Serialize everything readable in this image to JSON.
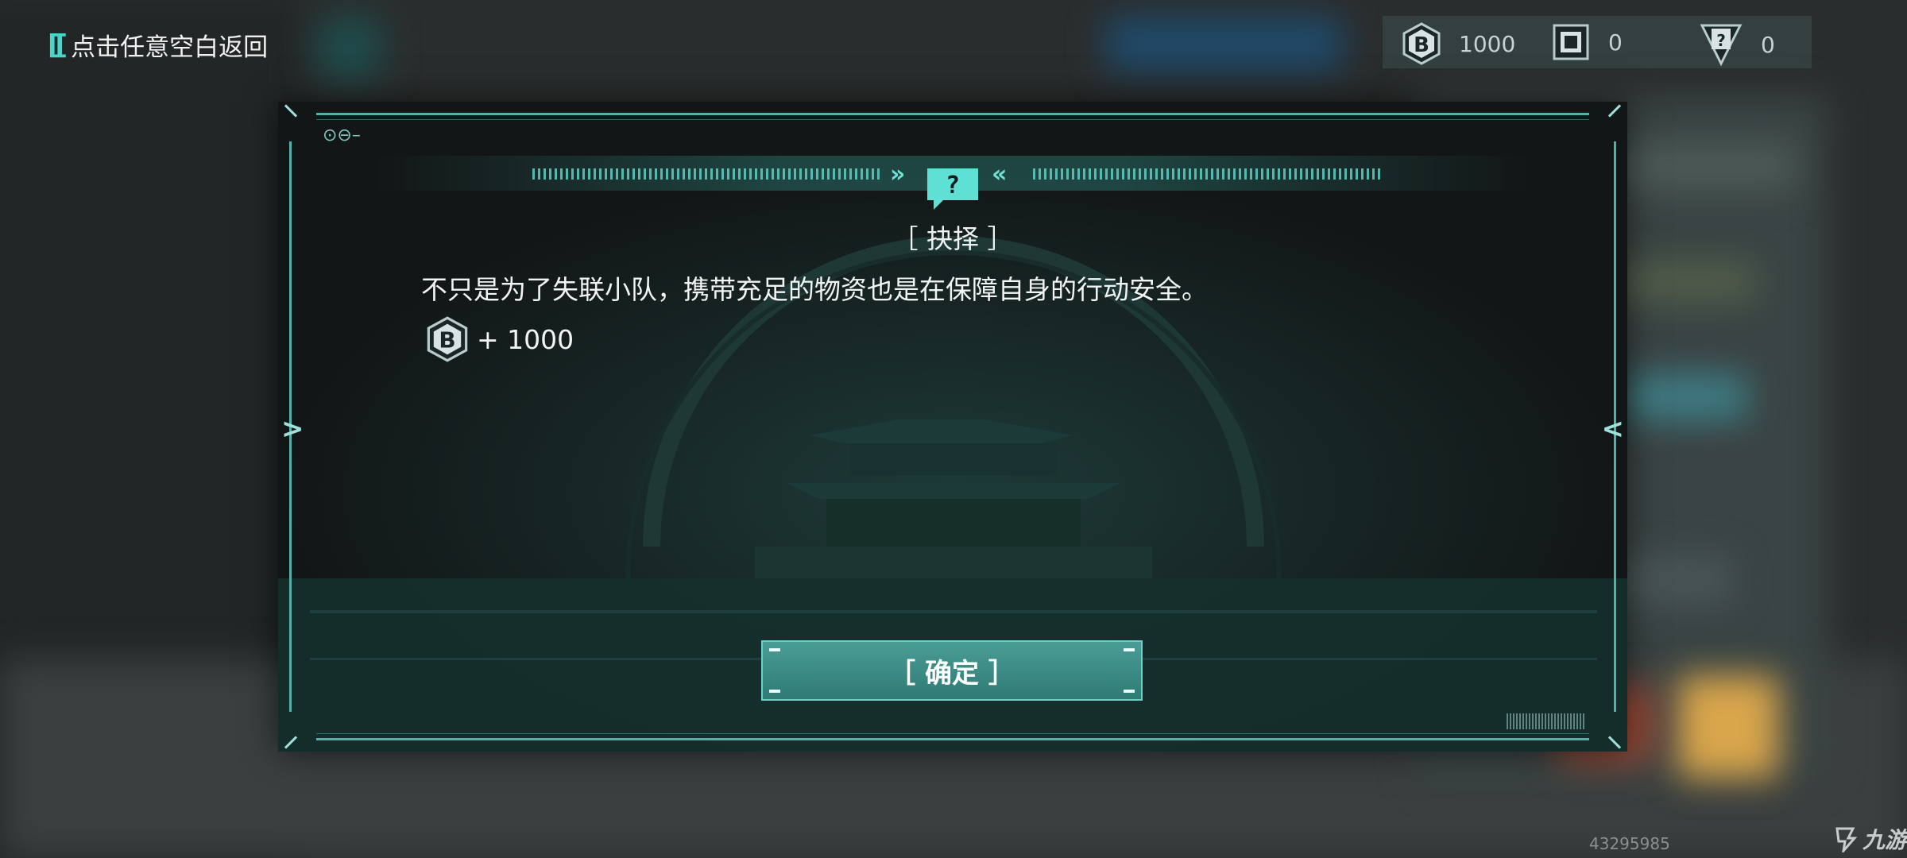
{
  "back_hint": {
    "icon": "double-bracket-icon",
    "text": "点击任意空白返回"
  },
  "currencies": [
    {
      "icon": "bit-coin-icon",
      "value": "1000"
    },
    {
      "icon": "chip-card-icon",
      "value": "0"
    },
    {
      "icon": "mystery-card-icon",
      "value": "0"
    }
  ],
  "modal": {
    "badge_icon": "question-speech-icon",
    "title": "［ 抉择 ］",
    "description": "不只是为了失联小队，携带充足的物资也是在保障自身的行动安全。",
    "reward": {
      "icon": "bit-coin-icon",
      "text": "+ 1000"
    },
    "confirm_label": "［ 确定 ］"
  },
  "watermark": {
    "number": "43295985",
    "logo_text": "九游"
  },
  "colors": {
    "accent": "#48d6cc",
    "panel": "#121616",
    "button": "#3a8a83"
  }
}
